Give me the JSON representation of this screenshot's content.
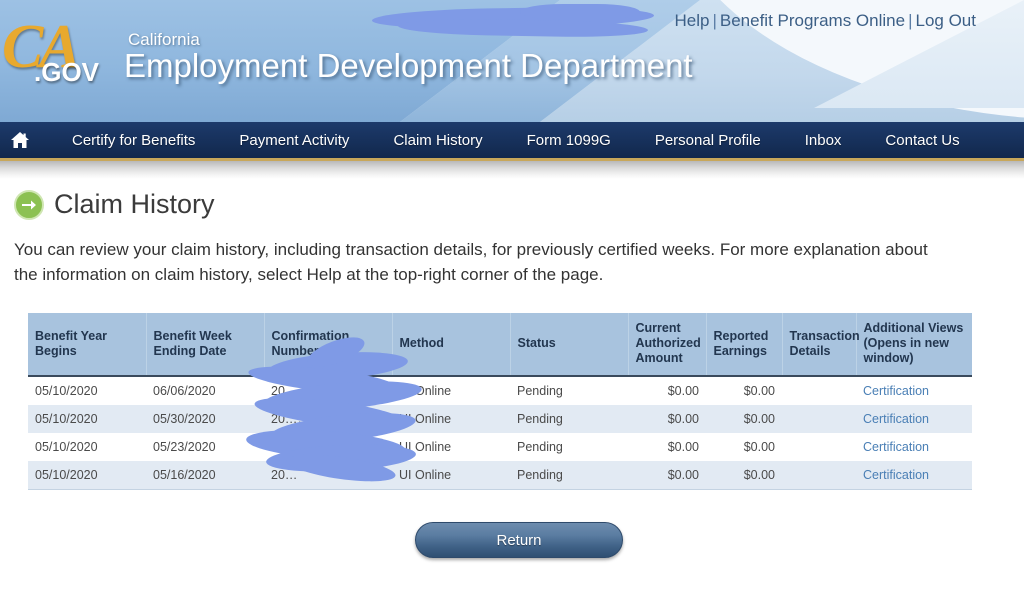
{
  "header": {
    "logo": {
      "ca": "CA",
      "gov": ".GOV"
    },
    "subtitle": "California",
    "title": "Employment Development Department",
    "links": {
      "help": "Help",
      "sep1": "|",
      "benefit_programs_online": "Benefit Programs Online",
      "sep2": "|",
      "log_out": "Log Out"
    },
    "redacted": true
  },
  "nav": {
    "home_icon": "home-icon",
    "items": [
      {
        "label": "Certify for Benefits"
      },
      {
        "label": "Payment Activity"
      },
      {
        "label": "Claim History"
      },
      {
        "label": "Form 1099G"
      },
      {
        "label": "Personal Profile"
      },
      {
        "label": "Inbox"
      },
      {
        "label": "Contact Us"
      }
    ]
  },
  "page": {
    "icon": "green-arrow-icon",
    "title": "Claim History",
    "intro": "You can review your claim history, including transaction details, for previously certified weeks. For more explanation about the information on claim history, select Help at the top-right corner of the page."
  },
  "table": {
    "columns": [
      "Benefit Year Begins",
      "Benefit Week Ending Date",
      "Confirmation Number",
      "Method",
      "Status",
      "Current Authorized Amount",
      "Reported Earnings",
      "Transaction Details",
      "Additional Views (Opens in new window)"
    ],
    "rows": [
      {
        "benefit_year_begins": "05/10/2020",
        "benefit_week_ending_date": "06/06/2020",
        "confirmation_number": "20……9287",
        "method": "UI Online",
        "status": "Pending",
        "current_authorized_amount": "$0.00",
        "reported_earnings": "$0.00",
        "transaction_details": "",
        "additional_views": "Certification"
      },
      {
        "benefit_year_begins": "05/10/2020",
        "benefit_week_ending_date": "05/30/2020",
        "confirmation_number": "20……7",
        "method": "UI Online",
        "status": "Pending",
        "current_authorized_amount": "$0.00",
        "reported_earnings": "$0.00",
        "transaction_details": "",
        "additional_views": "Certification"
      },
      {
        "benefit_year_begins": "05/10/2020",
        "benefit_week_ending_date": "05/23/2020",
        "confirmation_number": "20……273",
        "method": "UI Online",
        "status": "Pending",
        "current_authorized_amount": "$0.00",
        "reported_earnings": "$0.00",
        "transaction_details": "",
        "additional_views": "Certification"
      },
      {
        "benefit_year_begins": "05/10/2020",
        "benefit_week_ending_date": "05/16/2020",
        "confirmation_number": "20…",
        "method": "UI Online",
        "status": "Pending",
        "current_authorized_amount": "$0.00",
        "reported_earnings": "$0.00",
        "transaction_details": "",
        "additional_views": "Certification"
      }
    ]
  },
  "actions": {
    "return_label": "Return"
  },
  "colors": {
    "nav_bg": "#17315c",
    "nav_rule": "#c8a75a",
    "logo_gold": "#e8a92e",
    "table_header_bg": "#a8c3de",
    "row_alt_bg": "#e2eaf3",
    "link_blue": "#4a7fb5",
    "arrow_green": "#8cc152",
    "redaction_blue": "#7f9ae6"
  }
}
